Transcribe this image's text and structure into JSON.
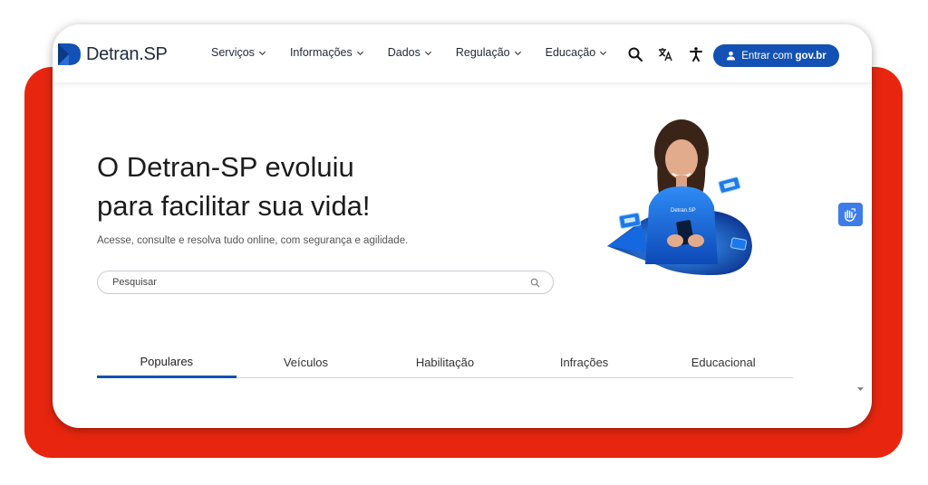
{
  "brand": {
    "name": "Detran",
    "suffix": ".SP"
  },
  "nav": {
    "items": [
      {
        "label": "Serviços"
      },
      {
        "label": "Informações"
      },
      {
        "label": "Dados"
      },
      {
        "label": "Regulação"
      },
      {
        "label": "Educação"
      }
    ]
  },
  "header_icons": {
    "search": "search-icon",
    "translate": "translate-icon",
    "accessibility": "accessibility-icon"
  },
  "login": {
    "prefix": "Entrar com",
    "provider": "gov.br"
  },
  "hero": {
    "title_line1": "O Detran-SP evoluiu",
    "title_line2": "para facilitar sua vida!",
    "subtitle": "Acesse, consulte e resolva tudo online, com segurança e agilidade.",
    "shirt_text": "Detran.SP"
  },
  "search": {
    "placeholder": "Pesquisar"
  },
  "tabs": [
    {
      "label": "Populares",
      "active": true
    },
    {
      "label": "Veículos",
      "active": false
    },
    {
      "label": "Habilitação",
      "active": false
    },
    {
      "label": "Infrações",
      "active": false
    },
    {
      "label": "Educacional",
      "active": false
    }
  ],
  "colors": {
    "accent": "#1351b4",
    "backdrop": "#e8260f",
    "fab": "#3d7de8"
  }
}
